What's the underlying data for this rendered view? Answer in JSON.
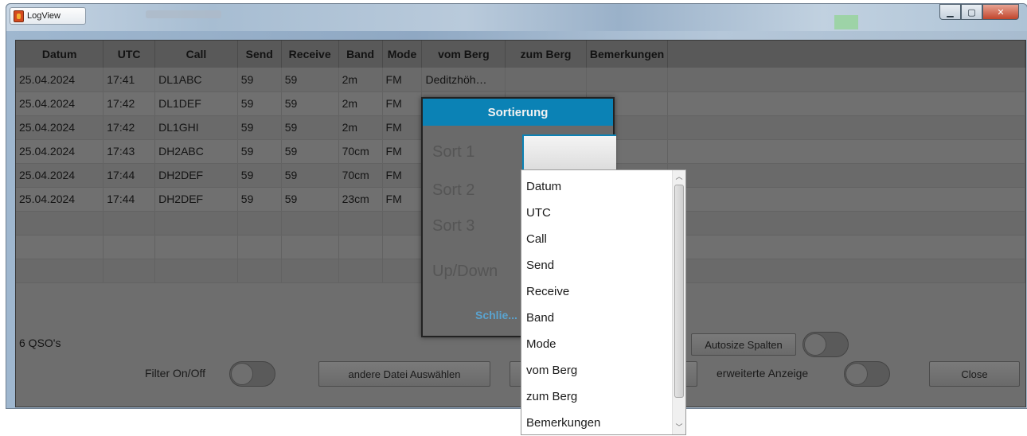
{
  "window": {
    "title": "LogView"
  },
  "table": {
    "columns": [
      "Datum",
      "UTC",
      "Call",
      "Send",
      "Receive",
      "Band",
      "Mode",
      "vom Berg",
      "zum Berg",
      "Bemerkungen"
    ],
    "rows": [
      [
        "25.04.2024",
        "17:41",
        "DL1ABC",
        "59",
        "59",
        "2m",
        "FM",
        "Deditzhöh…",
        "",
        ""
      ],
      [
        "25.04.2024",
        "17:42",
        "DL1DEF",
        "59",
        "59",
        "2m",
        "FM",
        "",
        "",
        ""
      ],
      [
        "25.04.2024",
        "17:42",
        "DL1GHI",
        "59",
        "59",
        "2m",
        "FM",
        "",
        "",
        ""
      ],
      [
        "25.04.2024",
        "17:43",
        "DH2ABC",
        "59",
        "59",
        "70cm",
        "FM",
        "",
        "",
        ""
      ],
      [
        "25.04.2024",
        "17:44",
        "DH2DEF",
        "59",
        "59",
        "70cm",
        "FM",
        "",
        "",
        ""
      ],
      [
        "25.04.2024",
        "17:44",
        "DH2DEF",
        "59",
        "59",
        "23cm",
        "FM",
        "",
        "",
        ""
      ],
      [
        "",
        "",
        "",
        "",
        "",
        "",
        "",
        "",
        "",
        ""
      ],
      [
        "",
        "",
        "",
        "",
        "",
        "",
        "",
        "",
        "",
        ""
      ],
      [
        "",
        "",
        "",
        "",
        "",
        "",
        "",
        "",
        "",
        ""
      ]
    ]
  },
  "status": {
    "count": "6 QSO's"
  },
  "bottom": {
    "filter_label": "Filter On/Off",
    "other_file_button": "andere Datei Auswählen",
    "autosize_button": "Autosize Spalten",
    "extended_label": "erweiterte Anzeige",
    "close_button": "Close"
  },
  "dialog": {
    "title": "Sortierung",
    "sort1": "Sort 1",
    "sort2": "Sort 2",
    "sort3": "Sort 3",
    "updown": "Up/Down",
    "close_link": "Schlie..."
  },
  "dropdown": {
    "options": [
      "Datum",
      "UTC",
      "Call",
      "Send",
      "Receive",
      "Band",
      "Mode",
      "vom Berg",
      "zum Berg",
      "Bemerkungen"
    ]
  },
  "colors": {
    "accent": "#0b82b5",
    "overlay": "#6e6e6e"
  }
}
